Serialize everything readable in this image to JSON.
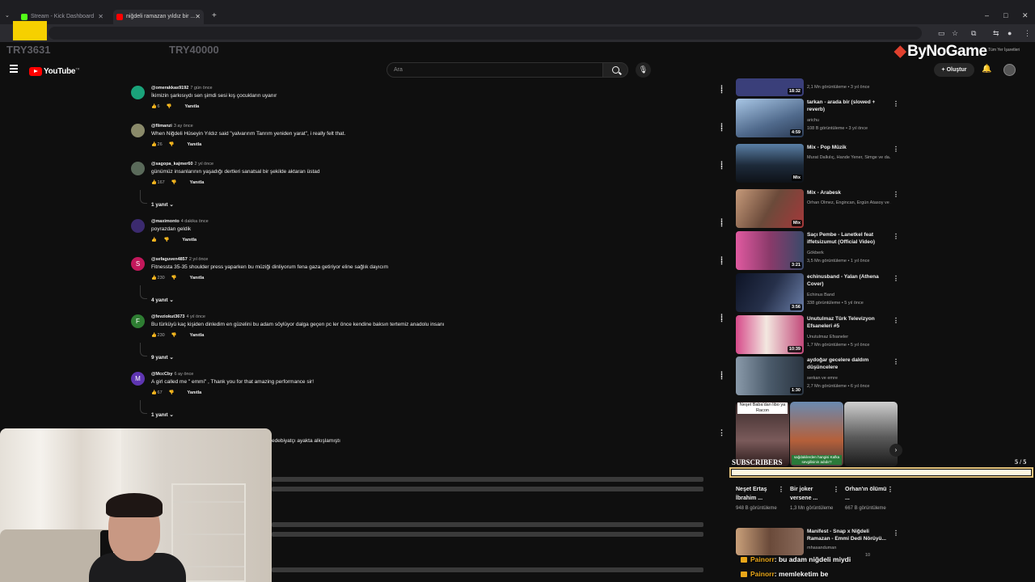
{
  "browser": {
    "tabs": [
      {
        "label": "Stream - Kick Dashboard",
        "color": "#53fc18"
      },
      {
        "label": "niğdeli ramazan yıldız bir ...",
        "color": "#ff0000"
      }
    ],
    "window_controls": [
      "–",
      "□",
      "✕"
    ]
  },
  "overlay": {
    "counter_left": "TRY3631",
    "counter_right": "TRY40000",
    "brand": "ByNoGame",
    "brand_note": "Tüm Yer İşaretleri"
  },
  "youtube": {
    "logo_text": "YouTube",
    "logo_sup": "TR",
    "search_placeholder": "Ara",
    "create_label": "+ Oluştur"
  },
  "comments": [
    {
      "user": "@omerakkas9192",
      "time": "7 gün önce",
      "text": "İkimizin şarkısıydı sen şimdi sesi kış çocukların uyanır",
      "likes": "6",
      "reply": "Yanıtla",
      "avatar_color": "#1aa37a",
      "avatar_letter": ""
    },
    {
      "user": "@flimanzi",
      "time": "3 ay önce",
      "text": "When Niğdeli Hüseyin Yıldız said \"yalvarırım Tanrım yeniden yarat\", i really felt that.",
      "likes": "26",
      "reply": "Yanıtla",
      "avatar_color": "#8a8a6a",
      "avatar_letter": ""
    },
    {
      "user": "@sagopa_kajmer60",
      "time": "2 yıl önce",
      "text": "günümüz  insanlarının yaşadığı dertleri sanatsal bir şekilde aktaran üstad",
      "likes": "167",
      "reply": "Yanıtla",
      "avatar_color": "#5a6a5a",
      "avatar_letter": ""
    },
    {
      "user": "@maximonto",
      "time": "4 dakika önce",
      "text": "poyrazdan geldik",
      "likes": "",
      "reply": "Yanıtla",
      "avatar_color": "#3b2a6e",
      "avatar_letter": ""
    },
    {
      "user": "@sefaguven4857",
      "time": "2 yıl önce",
      "text": "Fitnessta 35-35 shoulder press yaparken bu müziği dinliyorum fena gaza getiriyor eline sağlık dayıcım",
      "likes": "230",
      "reply": "Yanıtla",
      "avatar_color": "#c2185b",
      "avatar_letter": "S"
    },
    {
      "user": "@fevziokut3673",
      "time": "4 yıl önce",
      "text": "Bu türküyü kaç kişiden dinledim en güzelini bu adam söylüyor dalga geçen pc ler önce kendine baksın tertemiz anadolu insanı",
      "likes": "230",
      "reply": "Yanıtla",
      "avatar_color": "#2e7d32",
      "avatar_letter": "F"
    },
    {
      "user": "@MccCby",
      "time": "6 ay önce",
      "text": "A girl called me \" emmi\" , Thank you for that amazing performance sir!",
      "likes": "67",
      "reply": "Yanıtla",
      "avatar_color": "#5e35b1",
      "avatar_letter": "M"
    }
  ],
  "reply_toggles": [
    "1 yanıt",
    "4 yanıt",
    "9 yanıt",
    "1 yanıt"
  ],
  "partial_comment": "edebiyatçı ayakta alkışlamıştı",
  "sidebar_videos": [
    {
      "title": "",
      "channel": "",
      "meta": "2,1 Mn görüntüleme • 3 yıl önce",
      "duration": "18:32",
      "thumb": "#3a3f7a"
    },
    {
      "title": "tarkan - arada bir (slowed + reverb)",
      "channel": "arichu",
      "meta": "108 B görüntüleme • 3 yıl önce",
      "duration": "4:59",
      "thumb": "#5c6f8c"
    },
    {
      "title": "Mix - Pop Müzik",
      "channel": "Murat Dalkılıç, Hande Yener, Simge ve da...",
      "meta": "",
      "duration": "Mix",
      "thumb": "#1d2a3a"
    },
    {
      "title": "Mix - Arabesk",
      "channel": "Orhan Ölmez, Engincan, Ergün Atasoy ve ...",
      "meta": "",
      "duration": "Mix",
      "thumb": "#6b4a3a"
    },
    {
      "title": "Saçı Pembe - Lanetkel feat iffetsizumut (Official Video)",
      "channel": "Gökberk",
      "meta": "3,5 Mn görüntüleme • 1 yıl önce",
      "duration": "3:21",
      "thumb": "#8a3a6a"
    },
    {
      "title": "echinusband - Yalan (Athena Cover)",
      "channel": "Echinus Band",
      "meta": "338 görüntüleme • 5 yıl önce",
      "duration": "3:56",
      "thumb": "#26304a"
    },
    {
      "title": "Unutulmaz Türk Televizyon Efsaneleri #5",
      "channel": "Unutulmaz Efsaneler",
      "meta": "1,7 Mn görüntüleme • 5 yıl önce",
      "duration": "10:39",
      "thumb": "#c2497a"
    },
    {
      "title": "aydoğar gecelere daldım düşüncelere",
      "channel": "serkan ve emre",
      "meta": "2,7 Mn görüntüleme • 6 yıl önce",
      "duration": "1:30",
      "thumb": "#4a5a6a"
    }
  ],
  "shorts": [
    {
      "title": "Neşet Ertaş İbrahim ...",
      "views": "948 B görüntüleme",
      "caption": "Neşet Baba'dan libo ya Racon",
      "thumb": "#7a5a5a"
    },
    {
      "title": "Bir joker versene ...",
      "views": "1,3 Mn görüntüleme",
      "caption": "sağdakilerden hangisi Kafka sevgilisinin adıdır?",
      "thumb": "#b5603a"
    },
    {
      "title": "Orhan'ın ölümü ...",
      "views": "667 B görüntüleme",
      "caption": "",
      "thumb": "#5a5a5a"
    }
  ],
  "bottom_video": {
    "title": "Manifest - Snap x Niğdeli Ramazan - Emmi Dedi Nörüyü...",
    "channel": "mhasanduman",
    "meta": "10",
    "thumb": "#6a4a3a"
  },
  "subscribers": {
    "label": "SUBSCRIBERS",
    "count": "5 / 5",
    "progress": 1.0
  },
  "chat": [
    {
      "name": "Painorr",
      "message": ": bu adam niğdeli miydi"
    },
    {
      "name": "Painorr",
      "message": ": memleketim be"
    }
  ]
}
